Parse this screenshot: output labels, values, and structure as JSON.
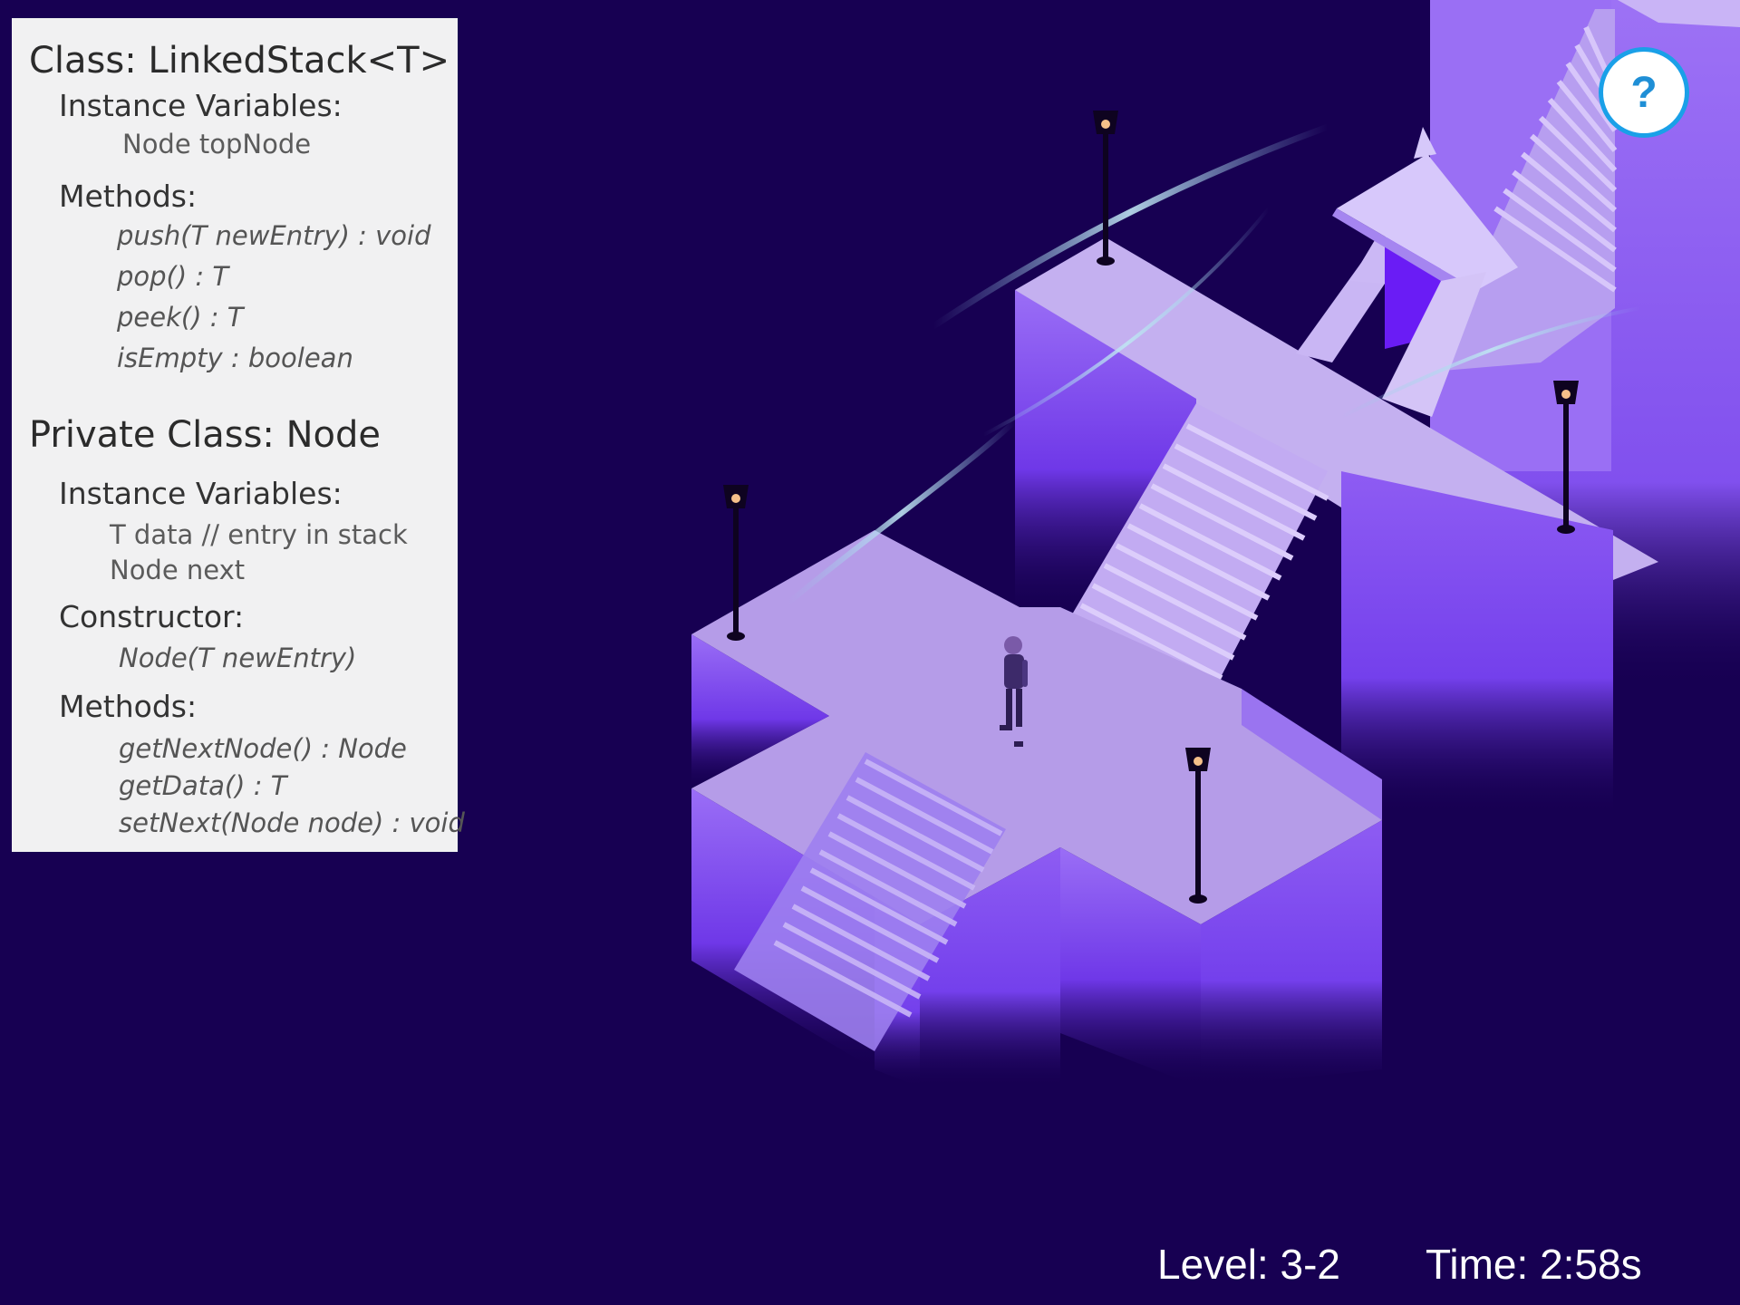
{
  "panel": {
    "class_title": "Class: LinkedStack<T>",
    "class_iv_heading": "Instance Variables:",
    "class_iv": [
      "Node topNode"
    ],
    "class_methods_heading": "Methods:",
    "class_methods": [
      "push(T newEntry) : void",
      "pop() : T",
      "peek() : T",
      "isEmpty : boolean"
    ],
    "node_title": "Private Class: Node",
    "node_iv_heading": "Instance Variables:",
    "node_iv": [
      "T data // entry in stack",
      "Node next"
    ],
    "node_ctor_heading": "Constructor:",
    "node_ctor": "Node(T newEntry)",
    "node_methods_heading": "Methods:",
    "node_methods": [
      "getNextNode() : Node",
      "getData() : T",
      "setNext(Node node) : void"
    ]
  },
  "help": {
    "label": "?"
  },
  "hud": {
    "level": "Level: 3-2",
    "time": "Time: 2:58s"
  },
  "colors": {
    "background": "#170052",
    "panel": "#f1f1f2",
    "platform_top": "#b9a2ec",
    "platform_side": "#8a5cf0",
    "help_ring": "#1aa0e8"
  }
}
